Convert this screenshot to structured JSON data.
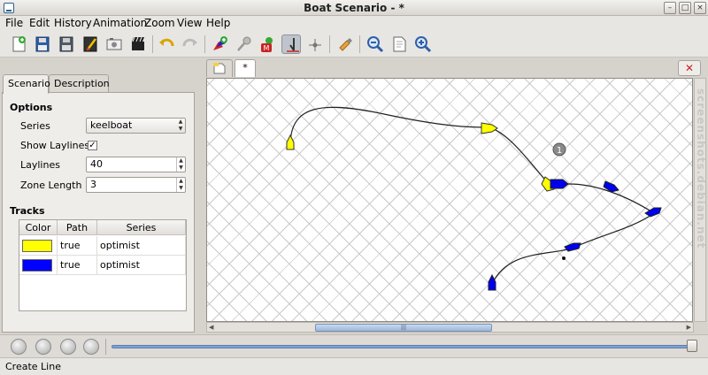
{
  "window": {
    "title": "Boat Scenario -  *",
    "buttons": [
      "–",
      "□",
      "×"
    ]
  },
  "menu": [
    "File",
    "Edit",
    "History",
    "Animation",
    "Zoom",
    "View",
    "Help"
  ],
  "toolbar": {
    "icons": [
      "new-file-icon",
      "open-file-icon",
      "save-icon",
      "save-as-icon",
      "export-image-icon",
      "export-animation-icon",
      "undo-icon",
      "redo-icon",
      "add-track-icon",
      "add-mark-icon",
      "add-mark-m-icon",
      "create-line-icon",
      "add-point-icon",
      "properties-icon",
      "zoom-out-icon",
      "zoom-fit-icon",
      "zoom-in-icon"
    ]
  },
  "panel": {
    "tabs": [
      "Scenario",
      "Description"
    ],
    "options_title": "Options",
    "series_label": "Series",
    "series_value": "keelboat",
    "laylines_label": "Show Laylines",
    "laylines_checked": "✓",
    "laylines_value_label": "Laylines",
    "laylines_value": "40",
    "zone_label": "Zone Length",
    "zone_value": "3",
    "tracks_title": "Tracks",
    "tracks_columns": [
      "Color",
      "Path",
      "Series"
    ],
    "tracks": [
      {
        "color": "#ffff00",
        "path": "true",
        "series": "optimist"
      },
      {
        "color": "#0000ff",
        "path": "true",
        "series": "optimist"
      }
    ]
  },
  "doc_tabs": [
    "",
    "*"
  ],
  "canvas": {
    "mark_label": "1"
  },
  "status": "Create Line",
  "watermark": "screenshots.debian.net"
}
